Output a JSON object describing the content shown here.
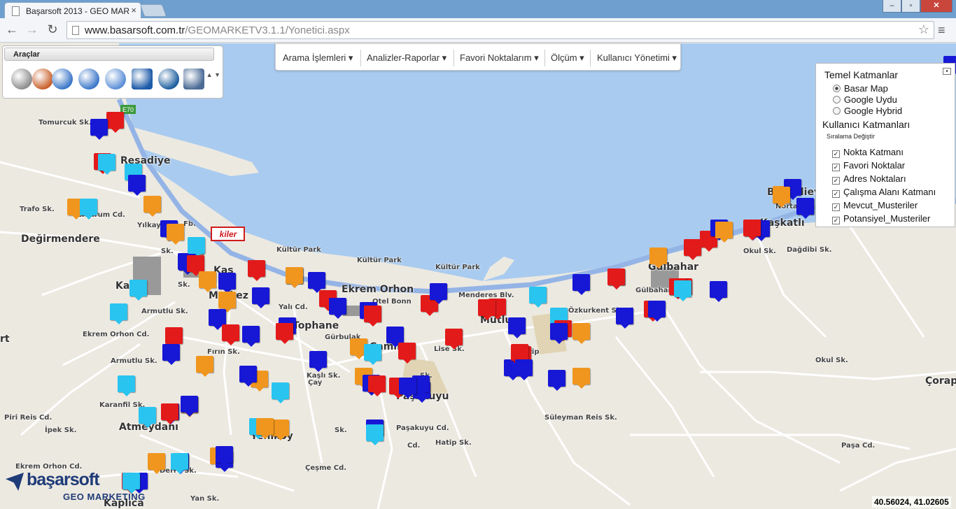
{
  "browser": {
    "tab_title": "Başarsoft 2013 - GEO MAR",
    "tab_close": "×",
    "url_host": "www.basarsoft.com.tr",
    "url_path": "/GEOMARKETV3.1.1/Yonetici.aspx",
    "minimize": "–",
    "maximize": "▫",
    "close": "✕",
    "back": "←",
    "forward": "→",
    "reload": "↻",
    "star": "☆",
    "menu": "≡"
  },
  "tools": {
    "title": "Araçlar",
    "items": [
      {
        "icon": "pan-icon",
        "color": "#8f8f8f"
      },
      {
        "icon": "select-icon",
        "color": "#c9602b"
      },
      {
        "icon": "zoom-in-icon",
        "color": "#3d78c9"
      },
      {
        "icon": "zoom-out-icon",
        "color": "#3d78c9"
      },
      {
        "icon": "zoom-extent-icon",
        "color": "#5c8fd6"
      },
      {
        "icon": "fullscreen-icon",
        "color": "#1e5ba8"
      },
      {
        "icon": "measure-icon",
        "color": "#1d5e9e"
      },
      {
        "icon": "print-icon",
        "color": "#4b6b96"
      }
    ],
    "scroll": "▲ ▼"
  },
  "menu": {
    "items": [
      "Arama İşlemleri ▾",
      "Analizler-Raporlar ▾",
      "Favori Noktalarım ▾",
      "Ölçüm ▾",
      "Kullanıcı Yönetimi ▾"
    ]
  },
  "layers": {
    "base_title": "Temel Katmanlar",
    "base": [
      {
        "label": "Basar Map",
        "checked": true
      },
      {
        "label": "Google Uydu",
        "checked": false
      },
      {
        "label": "Google Hybrid",
        "checked": false
      }
    ],
    "user_title": "Kullanıcı Katmanları",
    "sort_label": "Sıralama Değiştir",
    "user": [
      {
        "label": "Nokta Katmanı",
        "checked": true
      },
      {
        "label": "Favori Noktalar",
        "checked": true
      },
      {
        "label": "Adres Noktaları",
        "checked": true
      },
      {
        "label": "Çalışma Alanı Katmanı",
        "checked": true
      },
      {
        "label": "Mevcut_Musteriler",
        "checked": true
      },
      {
        "label": "Potansiyel_Musteriler",
        "checked": true
      }
    ],
    "collapse": "▪"
  },
  "map": {
    "colors": {
      "water": "#a9cbef",
      "land": "#ece9e1",
      "road": "#ffffff",
      "highway": "#94b4e6",
      "red": "#e31a1a",
      "blue": "#1717d6",
      "orange": "#f0961e",
      "cyan": "#29c4ef"
    },
    "road_shield": "E70",
    "brand_sign": "kiler",
    "places": [
      {
        "name": "Tomurcuk Sk.",
        "size": "sm"
      },
      {
        "name": "Reşadiye",
        "size": "lg"
      },
      {
        "name": "Değirmendere",
        "size": "lg"
      },
      {
        "name": "Trafo Sk.",
        "size": "sm"
      },
      {
        "name": "Erzurum Cd.",
        "size": "sm"
      },
      {
        "name": "Yılkay",
        "size": "sm"
      },
      {
        "name": "Fb.",
        "size": "sm"
      },
      {
        "name": "Kültür Park",
        "size": "sm"
      },
      {
        "name": "Kültür Park",
        "size": "sm"
      },
      {
        "name": "Kültür Park",
        "size": "sm"
      },
      {
        "name": "Ekrem Orhon",
        "size": "lg"
      },
      {
        "name": "Merkez",
        "size": "lg"
      },
      {
        "name": "Tophane",
        "size": "lg"
      },
      {
        "name": "Çamlı",
        "size": "lg"
      },
      {
        "name": "Otel Bonn",
        "size": "sm"
      },
      {
        "name": "Menderes Blv.",
        "size": "sm"
      },
      {
        "name": "Mutlu",
        "size": "lg"
      },
      {
        "name": "Gülbahar",
        "size": "lg"
      },
      {
        "name": "Gülbahar",
        "size": "sm"
      },
      {
        "name": "Bahçelievler",
        "size": "lg"
      },
      {
        "name": "Nortal",
        "size": "sm"
      },
      {
        "name": "Kaşkatlı",
        "size": "lg"
      },
      {
        "name": "Okul Sk.",
        "size": "sm"
      },
      {
        "name": "Dağdibi Sk.",
        "size": "sm"
      },
      {
        "name": "Okul Sk.",
        "size": "sm"
      },
      {
        "name": "Çorap",
        "size": "lg"
      },
      {
        "name": "Paşa Cd.",
        "size": "sm"
      },
      {
        "name": "Süleyman Reis Sk.",
        "size": "sm"
      },
      {
        "name": "Hatip Sk.",
        "size": "sm"
      },
      {
        "name": "Paşakuyu",
        "size": "lg"
      },
      {
        "name": "Paşakuyu Cd.",
        "size": "sm"
      },
      {
        "name": "Çeşme Cd.",
        "size": "sm"
      },
      {
        "name": "Yenikoy",
        "size": "lg"
      },
      {
        "name": "Atmeydanı",
        "size": "lg"
      },
      {
        "name": "Karanfil Sk.",
        "size": "sm"
      },
      {
        "name": "Armutlu Sk.",
        "size": "sm"
      },
      {
        "name": "Ekrem Orhon Cd.",
        "size": "sm"
      },
      {
        "name": "Piri Reis Cd.",
        "size": "sm"
      },
      {
        "name": "Kaplıca",
        "size": "lg"
      },
      {
        "name": "Yan Sk.",
        "size": "sm"
      },
      {
        "name": "Derre Sk.",
        "size": "sm"
      },
      {
        "name": "İpek Sk.",
        "size": "sm"
      },
      {
        "name": "Ekrem Orhon Cd.",
        "size": "sm"
      },
      {
        "name": "Hatip",
        "size": "sm"
      },
      {
        "name": "Lise Sk.",
        "size": "sm"
      },
      {
        "name": "Kaşlı Sk.",
        "size": "sm"
      },
      {
        "name": "Yalı Cd.",
        "size": "sm"
      },
      {
        "name": "Özkurkent Sitesi",
        "size": "sm"
      },
      {
        "name": "Armutlu Sk.",
        "size": "sm"
      },
      {
        "name": "Kaş",
        "size": "lg"
      },
      {
        "name": "Ka",
        "size": "lg"
      },
      {
        "name": "rt",
        "size": "lg"
      },
      {
        "name": "Gürbulak",
        "size": "sm"
      },
      {
        "name": "Sk.",
        "size": "sm"
      },
      {
        "name": "Sk.",
        "size": "sm"
      },
      {
        "name": "Fırın Sk.",
        "size": "sm"
      },
      {
        "name": "Çay",
        "size": "sm"
      },
      {
        "name": "Cd.",
        "size": "sm"
      },
      {
        "name": "Sk.",
        "size": "sm"
      },
      {
        "name": "Sk.",
        "size": "sm"
      }
    ],
    "markers": [
      {
        "c": "red"
      },
      {
        "c": "blue"
      },
      {
        "c": "red"
      },
      {
        "c": "cyan"
      },
      {
        "c": "cyan"
      },
      {
        "c": "blue"
      },
      {
        "c": "orange"
      },
      {
        "c": "cyan"
      },
      {
        "c": "orange"
      },
      {
        "c": "blue"
      },
      {
        "c": "orange"
      },
      {
        "c": "blue"
      },
      {
        "c": "cyan"
      },
      {
        "c": "blue"
      },
      {
        "c": "red"
      },
      {
        "c": "red"
      },
      {
        "c": "orange"
      },
      {
        "c": "blue"
      },
      {
        "c": "cyan"
      },
      {
        "c": "cyan"
      },
      {
        "c": "orange"
      },
      {
        "c": "blue"
      },
      {
        "c": "blue"
      },
      {
        "c": "blue"
      },
      {
        "c": "red"
      },
      {
        "c": "blue"
      },
      {
        "c": "red"
      },
      {
        "c": "red"
      },
      {
        "c": "blue"
      },
      {
        "c": "blue"
      },
      {
        "c": "orange"
      },
      {
        "c": "blue"
      },
      {
        "c": "red"
      },
      {
        "c": "blue"
      },
      {
        "c": "red"
      },
      {
        "c": "blue"
      },
      {
        "c": "orange"
      },
      {
        "c": "blue"
      },
      {
        "c": "orange"
      },
      {
        "c": "blue"
      },
      {
        "c": "cyan"
      },
      {
        "c": "red"
      },
      {
        "c": "blue"
      },
      {
        "c": "red"
      },
      {
        "c": "red"
      },
      {
        "c": "red"
      },
      {
        "c": "blue"
      },
      {
        "c": "orange"
      },
      {
        "c": "blue"
      },
      {
        "c": "blue"
      },
      {
        "c": "orange"
      },
      {
        "c": "blue"
      },
      {
        "c": "red"
      },
      {
        "c": "blue"
      },
      {
        "c": "blue"
      },
      {
        "c": "red"
      },
      {
        "c": "blue"
      },
      {
        "c": "red"
      },
      {
        "c": "red"
      },
      {
        "c": "blue"
      },
      {
        "c": "blue"
      },
      {
        "c": "orange"
      },
      {
        "c": "blue"
      },
      {
        "c": "red"
      },
      {
        "c": "blue"
      },
      {
        "c": "red"
      },
      {
        "c": "orange"
      },
      {
        "c": "blue"
      },
      {
        "c": "red"
      },
      {
        "c": "blue"
      },
      {
        "c": "red"
      },
      {
        "c": "orange"
      },
      {
        "c": "cyan"
      },
      {
        "c": "orange"
      },
      {
        "c": "cyan"
      },
      {
        "c": "blue"
      },
      {
        "c": "blue"
      },
      {
        "c": "cyan"
      },
      {
        "c": "cyan"
      },
      {
        "c": "red"
      },
      {
        "c": "blue"
      },
      {
        "c": "red"
      },
      {
        "c": "blue"
      },
      {
        "c": "red"
      },
      {
        "c": "blue"
      },
      {
        "c": "blue"
      },
      {
        "c": "red"
      },
      {
        "c": "orange"
      },
      {
        "c": "cyan"
      },
      {
        "c": "blue"
      },
      {
        "c": "blue"
      },
      {
        "c": "cyan"
      },
      {
        "c": "cyan"
      },
      {
        "c": "orange"
      },
      {
        "c": "blue"
      },
      {
        "c": "orange"
      },
      {
        "c": "orange"
      },
      {
        "c": "cyan"
      },
      {
        "c": "cyan"
      },
      {
        "c": "orange"
      },
      {
        "c": "orange"
      },
      {
        "c": "orange"
      },
      {
        "c": "blue"
      },
      {
        "c": "red"
      },
      {
        "c": "blue"
      },
      {
        "c": "orange"
      },
      {
        "c": "blue"
      },
      {
        "c": "cyan"
      },
      {
        "c": "blue"
      },
      {
        "c": "red"
      },
      {
        "c": "blue"
      },
      {
        "c": "cyan"
      },
      {
        "c": "blue"
      },
      {
        "c": "red"
      },
      {
        "c": "blue"
      }
    ]
  },
  "logo": {
    "word": "başarsoft",
    "sub": "GEO MARKETING"
  },
  "coords": "40.56024, 41.02605"
}
